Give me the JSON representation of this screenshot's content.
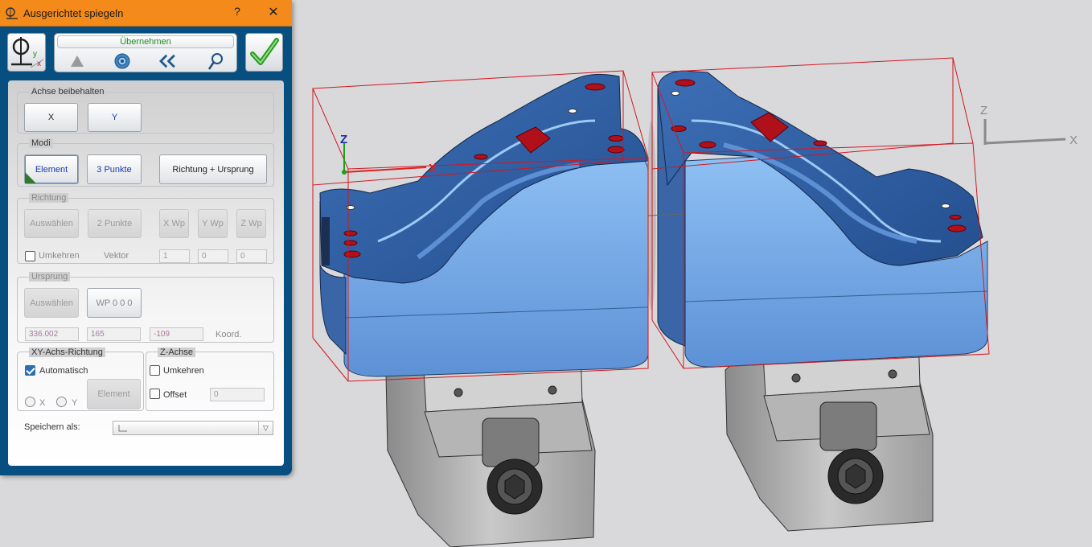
{
  "dialog": {
    "title": "Ausgerichtet spiegeln",
    "help": "?",
    "close": "✕",
    "apply_label": "Übernehmen",
    "icons": [
      "mirror-mode-icon",
      "warning-icon",
      "settings-gear-icon",
      "back-double-chevron-icon",
      "magnifier-icon",
      "confirm-checkmark-icon"
    ],
    "keep_axis": {
      "legend": "Achse beibehalten",
      "x_label": "X",
      "y_label": "Y"
    },
    "modes": {
      "legend": "Modi",
      "element_label": "Element",
      "three_points_label": "3 Punkte",
      "direction_origin_label": "Richtung + Ursprung"
    },
    "direction": {
      "legend": "Richtung",
      "select_label": "Auswählen",
      "two_points_label": "2 Punkte",
      "x_wp_label": "X Wp",
      "y_wp_label": "Y Wp",
      "z_wp_label": "Z Wp",
      "invert_label": "Umkehren",
      "vector_label": "Vektor",
      "vector_x": "1",
      "vector_y": "0",
      "vector_z": "0"
    },
    "origin": {
      "legend": "Ursprung",
      "select_label": "Auswählen",
      "wp_label": "WP 0 0 0",
      "coord_x": "336.002",
      "coord_y": "165",
      "coord_z": "-109",
      "coord_label": "Koord."
    },
    "xy_axis": {
      "legend": "XY-Achs-Richtung",
      "auto_label": "Automatisch",
      "auto_checked": true,
      "x_label": "X",
      "y_label": "Y",
      "element_label": "Element"
    },
    "z_axis": {
      "legend": "Z-Achse",
      "invert_label": "Umkehren",
      "offset_label": "Offset",
      "offset_value": "0"
    },
    "save_as_label": "Speichern als:"
  },
  "viewport": {
    "axis_labels": {
      "part_z": "Z",
      "part_x": "X",
      "world_z": "Z",
      "world_x": "X"
    },
    "colors": {
      "background": "#d9d9db",
      "part_blue": "#79aee8",
      "part_dark_blue": "#2f5fa4",
      "hole_red": "#b0101a",
      "vise_gray": "#b8b8b8",
      "bbox_red": "#d01820"
    }
  }
}
